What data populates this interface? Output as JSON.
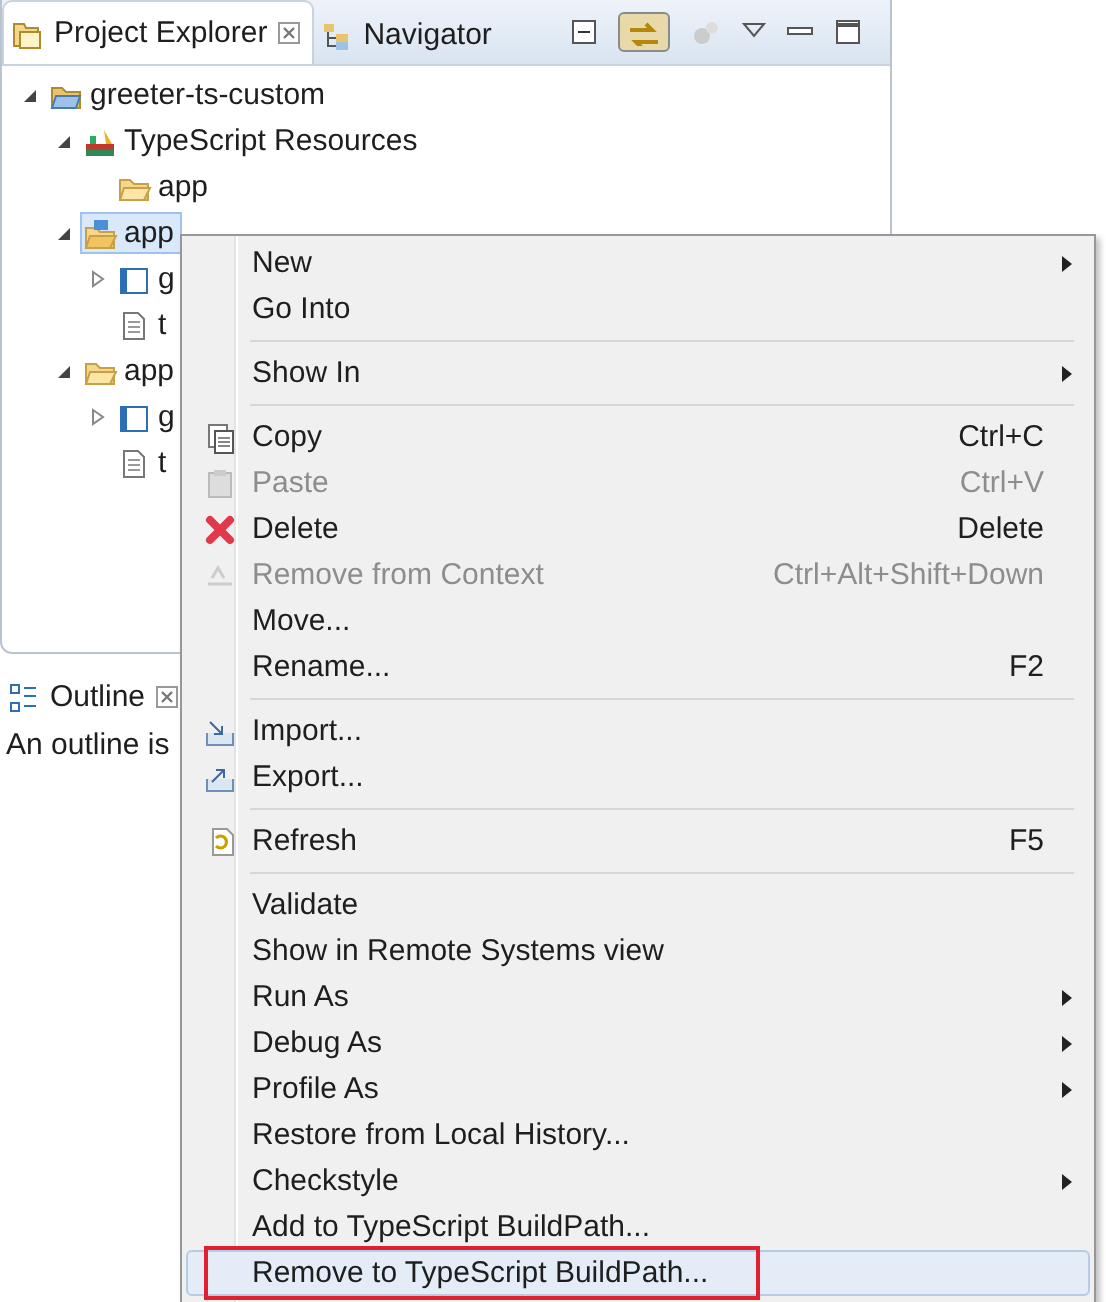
{
  "explorer": {
    "tabs": [
      {
        "label": "Project Explorer",
        "selected": true,
        "closable": true
      },
      {
        "label": "Navigator",
        "selected": false,
        "closable": false
      }
    ],
    "toolbar": [
      {
        "kind": "collapse",
        "pressed": false
      },
      {
        "kind": "link",
        "pressed": true
      },
      {
        "kind": "filter",
        "pressed": false
      },
      {
        "kind": "menu",
        "pressed": false
      },
      {
        "kind": "minimize",
        "pressed": false
      },
      {
        "kind": "maximize",
        "pressed": false
      }
    ],
    "tree": [
      {
        "label": "greeter-ts-custom",
        "kind": "project",
        "selected": false,
        "expanded": true,
        "children": [
          {
            "label": "TypeScript Resources",
            "kind": "library",
            "selected": false,
            "expanded": true,
            "children": [
              {
                "label": "app",
                "kind": "folder",
                "selected": false
              }
            ]
          },
          {
            "label": "app",
            "kind": "source-folder",
            "selected": true,
            "expanded": true,
            "children": [
              {
                "label": "g",
                "kind": "ts-file",
                "selected": false,
                "expanded": false
              },
              {
                "label": "t",
                "kind": "text-file",
                "selected": false
              }
            ]
          },
          {
            "label": "app",
            "kind": "folder",
            "selected": false,
            "expanded": true,
            "children": [
              {
                "label": "g",
                "kind": "ts-file",
                "selected": false,
                "expanded": false
              },
              {
                "label": "t",
                "kind": "text-file",
                "selected": false
              }
            ]
          }
        ]
      }
    ]
  },
  "outline": {
    "tab": {
      "label": "Outline",
      "selected": true,
      "closable": true
    },
    "message": "An outline is"
  },
  "context_menu": [
    {
      "kind": "item",
      "label": "New",
      "submenu": true,
      "disabled": false,
      "selected": false
    },
    {
      "kind": "item",
      "label": "Go Into",
      "disabled": false,
      "selected": false
    },
    {
      "kind": "separator"
    },
    {
      "kind": "item",
      "label": "Show In",
      "submenu": true,
      "disabled": false,
      "selected": false
    },
    {
      "kind": "separator"
    },
    {
      "label": "Copy",
      "shortcut": "Ctrl+C",
      "kind": "copy",
      "disabled": false,
      "selected": false
    },
    {
      "label": "Paste",
      "shortcut": "Ctrl+V",
      "kind": "paste",
      "disabled": true,
      "selected": false
    },
    {
      "label": "Delete",
      "shortcut": "Delete",
      "kind": "delete",
      "disabled": false,
      "selected": false
    },
    {
      "label": "Remove from Context",
      "shortcut": "Ctrl+Alt+Shift+Down",
      "kind": "context",
      "disabled": true,
      "selected": false
    },
    {
      "kind": "item",
      "label": "Move...",
      "disabled": false,
      "selected": false
    },
    {
      "kind": "item",
      "label": "Rename...",
      "shortcut": "F2",
      "disabled": false,
      "selected": false
    },
    {
      "kind": "separator"
    },
    {
      "label": "Import...",
      "kind": "import",
      "disabled": false,
      "selected": false
    },
    {
      "label": "Export...",
      "kind": "export",
      "disabled": false,
      "selected": false
    },
    {
      "kind": "separator"
    },
    {
      "label": "Refresh",
      "shortcut": "F5",
      "kind": "refresh",
      "disabled": false,
      "selected": false
    },
    {
      "kind": "separator"
    },
    {
      "kind": "item",
      "label": "Validate",
      "disabled": false,
      "selected": false
    },
    {
      "kind": "item",
      "label": "Show in Remote Systems view",
      "disabled": false,
      "selected": false
    },
    {
      "kind": "item",
      "label": "Run As",
      "submenu": true,
      "disabled": false,
      "selected": false
    },
    {
      "kind": "item",
      "label": "Debug As",
      "submenu": true,
      "disabled": false,
      "selected": false
    },
    {
      "kind": "item",
      "label": "Profile As",
      "submenu": true,
      "disabled": false,
      "selected": false
    },
    {
      "kind": "item",
      "label": "Restore from Local History...",
      "disabled": false,
      "selected": false
    },
    {
      "kind": "item",
      "label": "Checkstyle",
      "submenu": true,
      "disabled": false,
      "selected": false
    },
    {
      "kind": "item",
      "label": "Add to TypeScript BuildPath...",
      "disabled": false,
      "selected": false
    },
    {
      "kind": "item",
      "label": "Remove to TypeScript BuildPath...",
      "disabled": false,
      "selected": true,
      "outlined": true
    }
  ]
}
